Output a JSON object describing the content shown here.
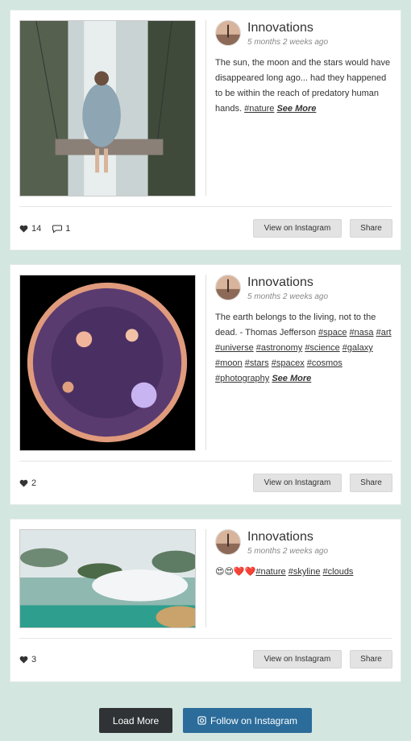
{
  "posts": [
    {
      "user": "Innovations",
      "ago": "5 months 2 weeks ago",
      "text": "The sun, the moon and the stars would have disappeared long ago... had they happened to be within the reach of predatory human hands. ",
      "tags": [
        "#nature"
      ],
      "see_more": "See More",
      "likes": "14",
      "comments": "1",
      "view_label": "View on Instagram",
      "share_label": "Share"
    },
    {
      "user": "Innovations",
      "ago": "5 months 2 weeks ago",
      "text": "The earth belongs to the living, not to the dead. - Thomas Jefferson ",
      "tags": [
        "#space",
        "#nasa",
        "#art",
        "#universe",
        "#astronomy",
        "#science",
        "#galaxy",
        "#moon",
        "#stars",
        "#spacex",
        "#cosmos",
        "#photography"
      ],
      "see_more": "See More",
      "likes": "2",
      "view_label": "View on Instagram",
      "share_label": "Share"
    },
    {
      "user": "Innovations",
      "ago": "5 months 2 weeks ago",
      "text": "😍😍❤️❤️",
      "tags": [
        "#nature",
        "#skyline",
        "#clouds"
      ],
      "likes": "3",
      "view_label": "View on Instagram",
      "share_label": "Share"
    }
  ],
  "footer": {
    "load_more": "Load More",
    "follow": "Follow on Instagram"
  },
  "icons": {
    "like": "heart-icon",
    "comment": "comment-icon",
    "instagram": "instagram-icon"
  },
  "colors": {
    "background": "#d3e6e0",
    "follow_button": "#2b6c9a",
    "load_more_button": "#2f3335"
  }
}
